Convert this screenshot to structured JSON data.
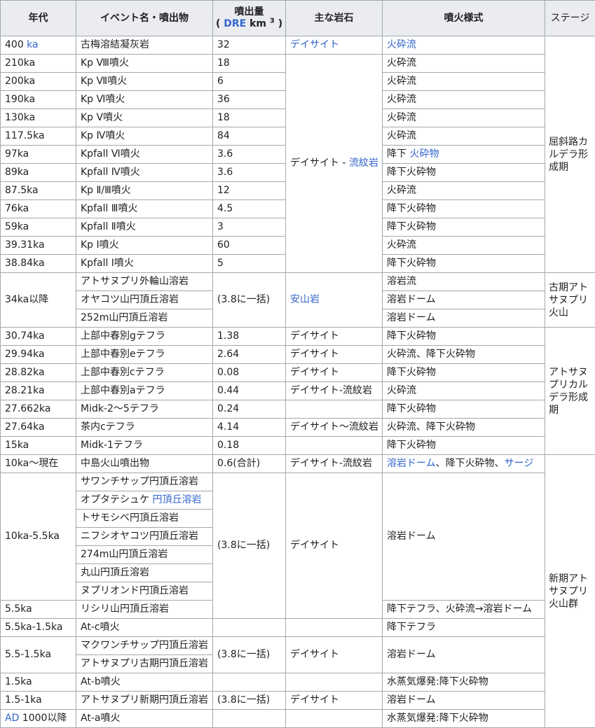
{
  "header": {
    "age": "年代",
    "event": "イベント名・噴出物",
    "volume_line1": "噴出量",
    "volume_open": "( ",
    "volume_dre": "DRE",
    "volume_unit": " km ",
    "volume_sup": "3",
    "volume_close": " )",
    "rock": "主な岩石",
    "style": "噴火様式",
    "stage": "ステージ"
  },
  "rows": [
    {
      "age": "400 ",
      "age_link": "ka",
      "event": "古梅溶結凝灰岩",
      "vol": "32",
      "rock": "デイサイト",
      "style": "火砕流"
    },
    {
      "age": "210ka",
      "event": "Kp Ⅷ噴火",
      "vol": "18",
      "style": "火砕流"
    },
    {
      "age": "200ka",
      "event": "Kp Ⅶ噴火",
      "vol": "6",
      "style": "火砕流"
    },
    {
      "age": "190ka",
      "event": "Kp Ⅵ噴火",
      "vol": "36",
      "style": "火砕流"
    },
    {
      "age": "130ka",
      "event": "Kp Ⅴ噴火",
      "vol": "18",
      "style": "火砕流"
    },
    {
      "age": "117.5ka",
      "event": "Kp Ⅳ噴火",
      "vol": "84",
      "style": "火砕流"
    },
    {
      "age": "97ka",
      "event": "Kpfall Ⅵ噴火",
      "vol": "3.6",
      "style": "降下 ",
      "style_link": "火砕物"
    },
    {
      "age": "89ka",
      "event": "Kpfall Ⅳ噴火",
      "vol": "3.6",
      "style": "降下火砕物"
    },
    {
      "age": "87.5ka",
      "event": "Kp Ⅱ/Ⅲ噴火",
      "vol": "12",
      "style": "火砕流"
    },
    {
      "age": "76ka",
      "event": "Kpfall Ⅲ噴火",
      "vol": "4.5",
      "style": "降下火砕物"
    },
    {
      "age": "59ka",
      "event": "Kpfall Ⅱ噴火",
      "vol": "3",
      "style": "降下火砕物"
    },
    {
      "age": "39.31ka",
      "event": "Kp Ⅰ噴火",
      "vol": "60",
      "style": "火砕流"
    },
    {
      "age": "38.84ka",
      "event": "Kpfall Ⅰ噴火",
      "vol": "5",
      "style": "降下火砕物"
    },
    {
      "age": "34ka以降",
      "event": "アトサヌプリ外輪山溶岩",
      "vol": "(3.8に一括)",
      "rock": "安山岩",
      "style": "溶岩流"
    },
    {
      "event": "オヤコツ山円頂丘溶岩",
      "style": "溶岩ドーム"
    },
    {
      "event": "252m山円頂丘溶岩",
      "style": "溶岩ドーム"
    },
    {
      "age": "30.74ka",
      "event": "上部中春別gテフラ",
      "vol": "1.38",
      "rock": "デイサイト",
      "style": "降下火砕物"
    },
    {
      "age": "29.94ka",
      "event": "上部中春別eテフラ",
      "vol": "2.64",
      "rock": "デイサイト",
      "style": "火砕流、降下火砕物"
    },
    {
      "age": "28.82ka",
      "event": "上部中春別cテフラ",
      "vol": "0.08",
      "rock": "デイサイト",
      "style": "降下火砕物"
    },
    {
      "age": "28.21ka",
      "event": "上部中春別aテフラ",
      "vol": "0.44",
      "rock": "デイサイト-流紋岩",
      "style": "火砕流"
    },
    {
      "age": "27.662ka",
      "event": "Midk-2～5テフラ",
      "vol": "0.24",
      "rock": "",
      "style": "降下火砕物"
    },
    {
      "age": "27.64ka",
      "event": "茶内cテフラ",
      "vol": "4.14",
      "rock": "デイサイト～流紋岩",
      "style": "火砕流、降下火砕物"
    },
    {
      "age": "15ka",
      "event": "Midk-1テフラ",
      "vol": "0.18",
      "rock": "",
      "style": "降下火砕物"
    },
    {
      "age": "10ka～現在",
      "event": "中島火山噴出物",
      "vol": "0.6(合計)",
      "rock": "デイサイト-流紋岩",
      "style_link": "溶岩ドーム",
      "style": "、降下火砕物、",
      "style_link2": "サージ"
    },
    {
      "age": "10ka-5.5ka",
      "event": "サワンチサップ円頂丘溶岩",
      "vol": "(3.8に一括)",
      "rock": "デイサイト",
      "style": "溶岩ドーム"
    },
    {
      "event": "オプタテシュケ ",
      "event_link": "円頂丘溶岩"
    },
    {
      "event": "トサモシベ円頂丘溶岩"
    },
    {
      "event": "ニフシオヤコツ円頂丘溶岩"
    },
    {
      "event": "274m山円頂丘溶岩"
    },
    {
      "event": "丸山円頂丘溶岩"
    },
    {
      "event": "ヌプリオンド円頂丘溶岩"
    },
    {
      "age": "5.5ka",
      "event": "リシリ山円頂丘溶岩",
      "style": "降下テフラ、火砕流→溶岩ドーム"
    },
    {
      "age": "5.5ka-1.5ka",
      "event": "At-c噴火",
      "vol": "",
      "rock": "",
      "style": "降下テフラ"
    },
    {
      "age": "5.5-1.5ka",
      "event": "マクワンチサップ円頂丘溶岩",
      "vol": "(3.8に一括)",
      "rock": "デイサイト",
      "style": "溶岩ドーム"
    },
    {
      "event": "アトサヌプリ古期円頂丘溶岩"
    },
    {
      "age": "1.5ka",
      "event": "At-b噴火",
      "vol": "",
      "rock": "",
      "style": "水蒸気爆発:降下火砕物"
    },
    {
      "age": "1.5-1ka",
      "event": "アトサヌプリ新期円頂丘溶岩",
      "vol": "(3.8に一括)",
      "rock": "デイサイト",
      "style": "溶岩ドーム"
    },
    {
      "age_link": "AD",
      "age": " 1000以降",
      "event": "At-a噴火",
      "vol": "",
      "rock": "",
      "style": "水蒸気爆発:降下火砕物"
    }
  ],
  "merged": {
    "rock_kp": "デイサイト - ",
    "rock_kp_link": "流紋岩",
    "stage1": "屈斜路カルデラ形成期",
    "stage2": "古期アトサヌプリ火山",
    "stage3": "アトサヌプリカルデラ形成期",
    "stage4": "新期アトサヌプリ火山群"
  }
}
